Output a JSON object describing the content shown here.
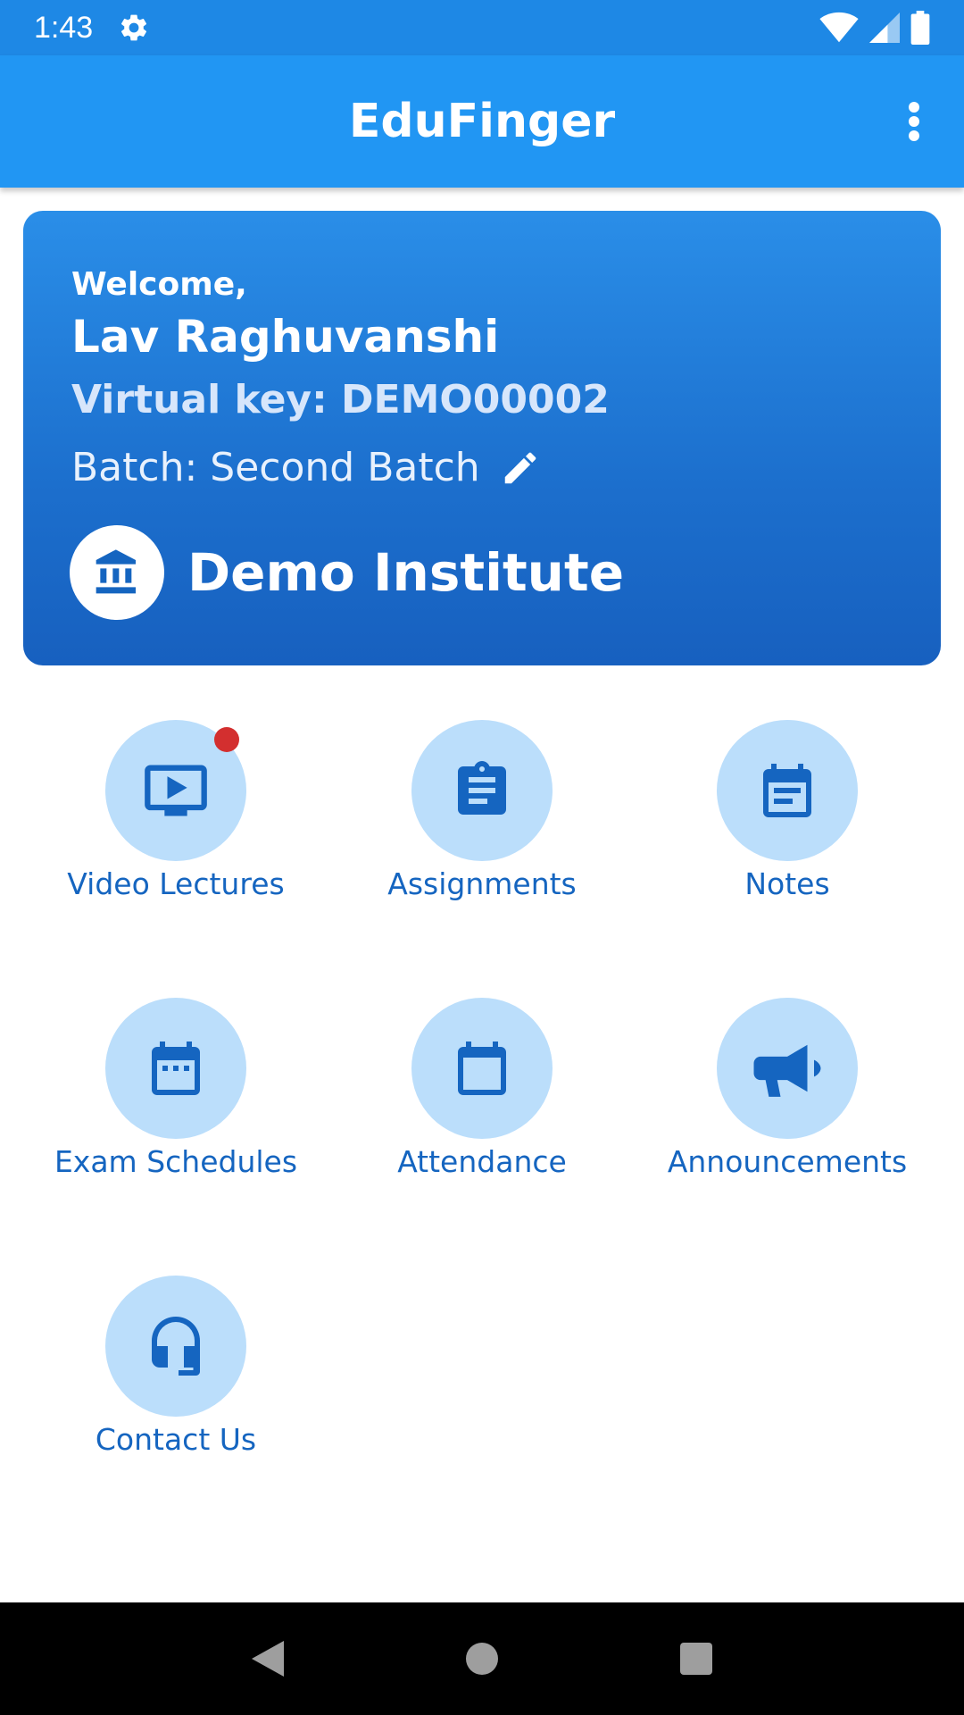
{
  "status_bar": {
    "time": "1:43"
  },
  "app_bar": {
    "title": "EduFinger"
  },
  "welcome_card": {
    "greeting": "Welcome,",
    "user_name": "Lav Raghuvanshi",
    "virtual_key": "Virtual key: DEMO00002",
    "batch": "Batch: Second Batch",
    "institute": "Demo Institute"
  },
  "menu": {
    "items": [
      {
        "label": "Video Lectures",
        "icon": "video-lecture-icon",
        "has_badge": true
      },
      {
        "label": "Assignments",
        "icon": "assignment-icon",
        "has_badge": false
      },
      {
        "label": "Notes",
        "icon": "notes-icon",
        "has_badge": false
      },
      {
        "label": "Exam Schedules",
        "icon": "exam-calendar-icon",
        "has_badge": false
      },
      {
        "label": "Attendance",
        "icon": "attendance-calendar-icon",
        "has_badge": false
      },
      {
        "label": "Announcements",
        "icon": "megaphone-icon",
        "has_badge": false
      },
      {
        "label": "Contact Us",
        "icon": "headset-icon",
        "has_badge": false
      }
    ]
  },
  "colors": {
    "primary": "#2196f3",
    "status_bar": "#1e88e5",
    "tile_circle": "#bbdefb",
    "tile_icon": "#1565c0",
    "badge": "#d32f2f"
  }
}
